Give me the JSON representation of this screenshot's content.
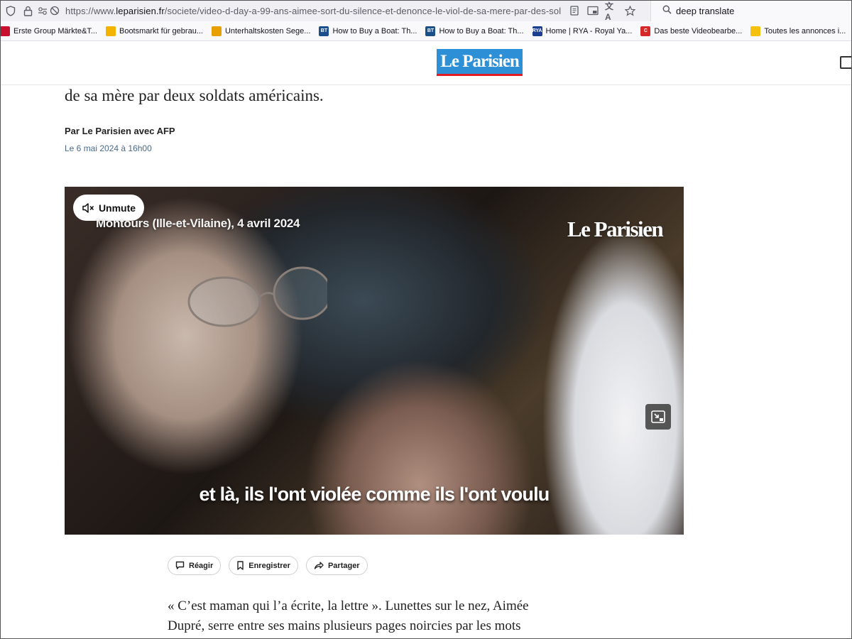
{
  "browser": {
    "url_prefix": "https://www.",
    "url_domain": "leparisien.fr",
    "url_path": "/societe/video-d-day-a-99-ans-aimee-sort-du-silence-et-denonce-le-viol-de-sa-mere-par-des-sol",
    "search_text": "deep translate",
    "icons": [
      "shield-icon",
      "lock-icon",
      "permissions-icon",
      "reader-view-icon",
      "pip-icon",
      "translate-icon",
      "star-icon",
      "search-icon"
    ]
  },
  "bookmarks": [
    {
      "label": "Erste Group Märkte&T...",
      "icon_color": "#c8102e",
      "glyph": ""
    },
    {
      "label": "Bootsmarkt für gebrau...",
      "icon_color": "#f2b400",
      "glyph": ""
    },
    {
      "label": "Unterhaltskosten Sege...",
      "icon_color": "#e8a000",
      "glyph": ""
    },
    {
      "label": "How to Buy a Boat: Th...",
      "icon_color": "#1a4f8a",
      "glyph": "BT"
    },
    {
      "label": "How to Buy a Boat: Th...",
      "icon_color": "#1a4f8a",
      "glyph": "BT"
    },
    {
      "label": "Home | RYA - Royal Ya...",
      "icon_color": "#1d3f8f",
      "glyph": "RYA"
    },
    {
      "label": "Das beste Videobearbe...",
      "icon_color": "#d62828",
      "glyph": "C"
    },
    {
      "label": "Toutes les annonces i...",
      "icon_color": "#f4c20d",
      "glyph": ""
    }
  ],
  "site": {
    "logo": "Le Parisien"
  },
  "article": {
    "lead": "de sa mère par deux soldats américains.",
    "byline": "Par Le Parisien avec AFP",
    "date": "Le 6 mai 2024 à 16h00",
    "video": {
      "unmute_label": "Unmute",
      "location_caption": "Montours (Ille-et-Vilaine), 4 avril 2024",
      "watermark": "Le Parisien",
      "subtitle": "et là, ils l'ont violée comme ils l'ont voulu"
    },
    "actions": {
      "react": "Réagir",
      "save": "Enregistrer",
      "share": "Partager"
    },
    "paragraph_line1": "« C’est maman qui l’a écrite, la lettre ». Lunettes sur le nez, Aimée",
    "paragraph_line2": "Dupré, serre entre ses mains plusieurs pages noircies par les mots"
  }
}
